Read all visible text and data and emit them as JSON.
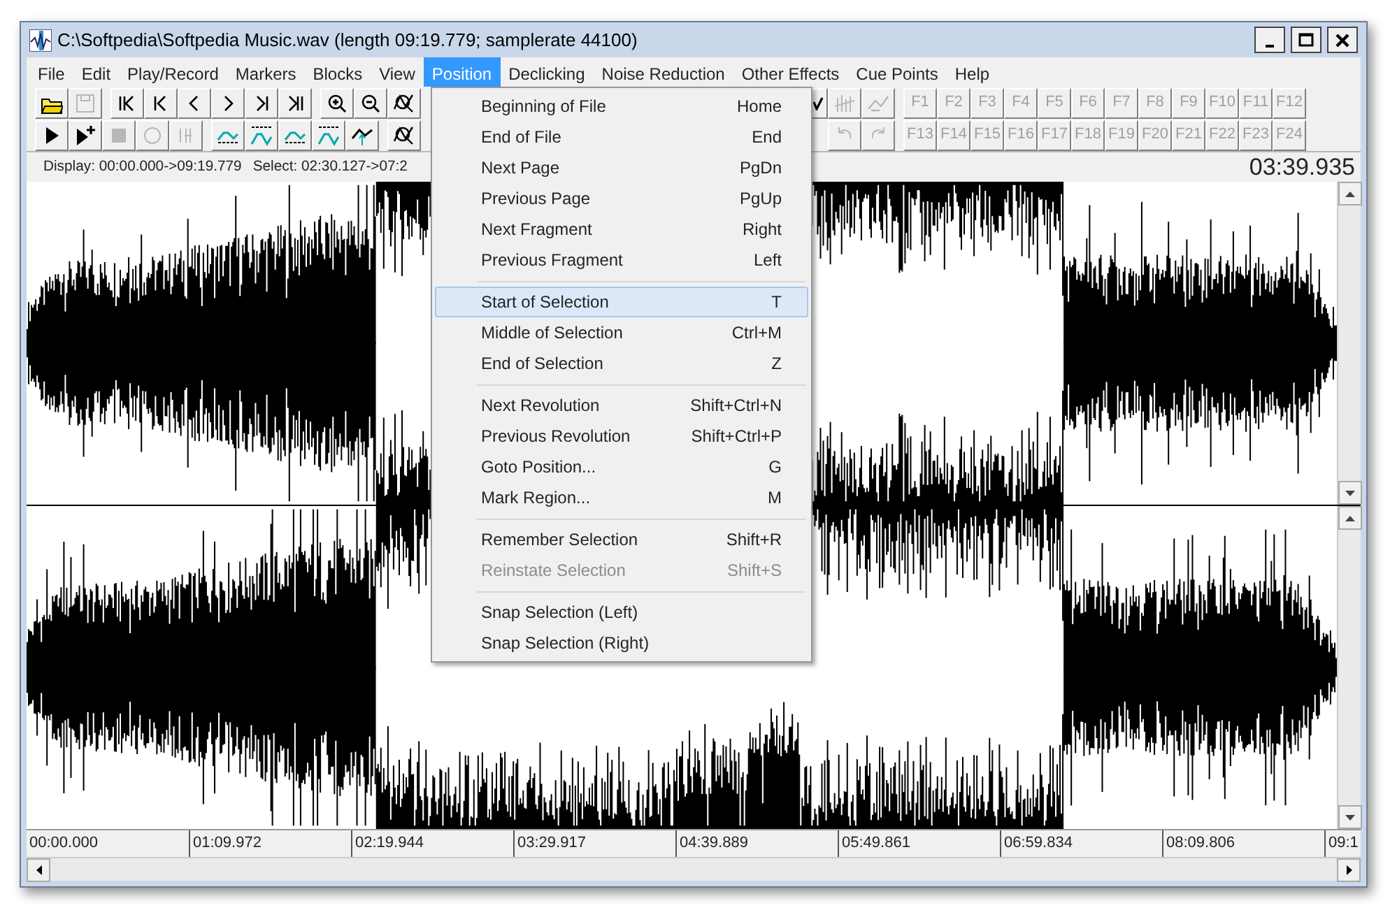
{
  "window": {
    "title": "C:\\Softpedia\\Softpedia Music.wav (length 09:19.779; samplerate 44100)"
  },
  "menu": {
    "items": [
      {
        "label": "File",
        "selected": false
      },
      {
        "label": "Edit",
        "selected": false
      },
      {
        "label": "Play/Record",
        "selected": false
      },
      {
        "label": "Markers",
        "selected": false
      },
      {
        "label": "Blocks",
        "selected": false
      },
      {
        "label": "View",
        "selected": false
      },
      {
        "label": "Position",
        "selected": true
      },
      {
        "label": "Declicking",
        "selected": false
      },
      {
        "label": "Noise Reduction",
        "selected": false
      },
      {
        "label": "Other Effects",
        "selected": false
      },
      {
        "label": "Cue Points",
        "selected": false
      },
      {
        "label": "Help",
        "selected": false
      }
    ]
  },
  "toolbar": {
    "rows": [
      {
        "left": [
          [
            {
              "kind": "folder",
              "disabled": false
            },
            {
              "kind": "save",
              "disabled": true
            }
          ],
          [
            {
              "kind": "first",
              "disabled": false
            },
            {
              "kind": "pageback",
              "disabled": false
            },
            {
              "kind": "back",
              "disabled": false
            },
            {
              "kind": "forward",
              "disabled": false
            },
            {
              "kind": "pageforward",
              "disabled": false
            },
            {
              "kind": "last",
              "disabled": false
            }
          ],
          [
            {
              "kind": "zoomin",
              "disabled": false
            },
            {
              "kind": "zoomout",
              "disabled": false
            },
            {
              "kind": "zoomfit",
              "disabled": false
            }
          ]
        ],
        "right": [
          [
            {
              "kind": "curve"
            },
            {
              "kind": "split",
              "disabled": true
            },
            {
              "kind": "join",
              "disabled": true
            }
          ],
          [
            {
              "kind": "key",
              "label": "F1",
              "disabled": true
            },
            {
              "kind": "key",
              "label": "F2",
              "disabled": true
            },
            {
              "kind": "key",
              "label": "F3",
              "disabled": true
            },
            {
              "kind": "key",
              "label": "F4",
              "disabled": true
            },
            {
              "kind": "key",
              "label": "F5",
              "disabled": true
            },
            {
              "kind": "key",
              "label": "F6",
              "disabled": true
            },
            {
              "kind": "key",
              "label": "F7",
              "disabled": true
            },
            {
              "kind": "key",
              "label": "F8",
              "disabled": true
            },
            {
              "kind": "key",
              "label": "F9",
              "disabled": true
            },
            {
              "kind": "key",
              "label": "F10",
              "disabled": true
            },
            {
              "kind": "key",
              "label": "F11",
              "disabled": true
            },
            {
              "kind": "key",
              "label": "F12",
              "disabled": true
            }
          ]
        ]
      },
      {
        "left": [
          [
            {
              "kind": "play",
              "disabled": false
            },
            {
              "kind": "playplus",
              "disabled": false
            },
            {
              "kind": "stop",
              "disabled": true
            },
            {
              "kind": "record",
              "disabled": true
            },
            {
              "kind": "meter",
              "disabled": true
            }
          ],
          [
            {
              "kind": "fadein",
              "disabled": false
            },
            {
              "kind": "fadeout",
              "disabled": false
            },
            {
              "kind": "fadein",
              "disabled": false
            },
            {
              "kind": "fadeout",
              "disabled": false
            },
            {
              "kind": "boost",
              "disabled": false
            }
          ],
          [
            {
              "kind": "zoomfit",
              "disabled": false
            }
          ]
        ],
        "right": [
          [
            {
              "kind": "undo",
              "disabled": true
            },
            {
              "kind": "redo",
              "disabled": true
            }
          ],
          [
            {
              "kind": "key",
              "label": "F13",
              "disabled": true
            },
            {
              "kind": "key",
              "label": "F14",
              "disabled": true
            },
            {
              "kind": "key",
              "label": "F15",
              "disabled": true
            },
            {
              "kind": "key",
              "label": "F16",
              "disabled": true
            },
            {
              "kind": "key",
              "label": "F17",
              "disabled": true
            },
            {
              "kind": "key",
              "label": "F18",
              "disabled": true
            },
            {
              "kind": "key",
              "label": "F19",
              "disabled": true
            },
            {
              "kind": "key",
              "label": "F20",
              "disabled": true
            },
            {
              "kind": "key",
              "label": "F21",
              "disabled": true
            },
            {
              "kind": "key",
              "label": "F22",
              "disabled": true
            },
            {
              "kind": "key",
              "label": "F23",
              "disabled": true
            },
            {
              "kind": "key",
              "label": "F24",
              "disabled": true
            }
          ]
        ]
      }
    ]
  },
  "status": {
    "display": "Display: 00:00.000->09:19.779",
    "select": "Select: 02:30.127->07:2",
    "time": "03:39.935"
  },
  "ruler": [
    "00:00.000",
    "01:09.972",
    "02:19.944",
    "03:29.917",
    "04:39.889",
    "05:49.861",
    "06:59.834",
    "08:09.806",
    "09:1"
  ],
  "dropdown": [
    {
      "kind": "item",
      "label": "Beginning of File",
      "shortcut": "Home",
      "selected": false,
      "disabled": false
    },
    {
      "kind": "item",
      "label": "End of File",
      "shortcut": "End",
      "selected": false,
      "disabled": false
    },
    {
      "kind": "item",
      "label": "Next Page",
      "shortcut": "PgDn",
      "selected": false,
      "disabled": false
    },
    {
      "kind": "item",
      "label": "Previous Page",
      "shortcut": "PgUp",
      "selected": false,
      "disabled": false
    },
    {
      "kind": "item",
      "label": "Next Fragment",
      "shortcut": "Right",
      "selected": false,
      "disabled": false
    },
    {
      "kind": "item",
      "label": "Previous Fragment",
      "shortcut": "Left",
      "selected": false,
      "disabled": false
    },
    {
      "kind": "separator"
    },
    {
      "kind": "item",
      "label": "Start of Selection",
      "shortcut": "T",
      "selected": true,
      "disabled": false
    },
    {
      "kind": "item",
      "label": "Middle of Selection",
      "shortcut": "Ctrl+M",
      "selected": false,
      "disabled": false
    },
    {
      "kind": "item",
      "label": "End of Selection",
      "shortcut": "Z",
      "selected": false,
      "disabled": false
    },
    {
      "kind": "separator"
    },
    {
      "kind": "item",
      "label": "Next Revolution",
      "shortcut": "Shift+Ctrl+N",
      "selected": false,
      "disabled": false
    },
    {
      "kind": "item",
      "label": "Previous Revolution",
      "shortcut": "Shift+Ctrl+P",
      "selected": false,
      "disabled": false
    },
    {
      "kind": "item",
      "label": "Goto Position...",
      "shortcut": "G",
      "selected": false,
      "disabled": false
    },
    {
      "kind": "item",
      "label": "Mark Region...",
      "shortcut": "M",
      "selected": false,
      "disabled": false
    },
    {
      "kind": "separator"
    },
    {
      "kind": "item",
      "label": "Remember Selection",
      "shortcut": "Shift+R",
      "selected": false,
      "disabled": false
    },
    {
      "kind": "item",
      "label": "Reinstate Selection",
      "shortcut": "Shift+S",
      "selected": false,
      "disabled": true
    },
    {
      "kind": "separator"
    },
    {
      "kind": "item",
      "label": "Snap Selection (Left)",
      "selected": false,
      "disabled": false
    },
    {
      "kind": "item",
      "label": "Snap Selection (Right)",
      "selected": false,
      "disabled": false
    }
  ]
}
